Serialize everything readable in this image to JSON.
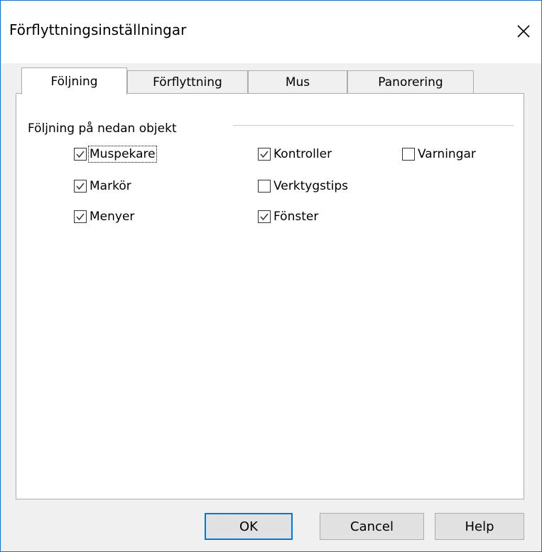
{
  "window": {
    "title": "Förflyttningsinställningar"
  },
  "tabs": [
    {
      "label": "Följning",
      "active": true
    },
    {
      "label": "Förflyttning",
      "active": false
    },
    {
      "label": "Mus",
      "active": false
    },
    {
      "label": "Panorering",
      "active": false
    }
  ],
  "group": {
    "label": "Följning på nedan objekt"
  },
  "checkboxes": [
    {
      "label": "Muspekare",
      "checked": true
    },
    {
      "label": "Markör",
      "checked": true
    },
    {
      "label": "Menyer",
      "checked": true
    },
    {
      "label": "Kontroller",
      "checked": true
    },
    {
      "label": "Verktygstips",
      "checked": false
    },
    {
      "label": "Fönster",
      "checked": true
    },
    {
      "label": "Varningar",
      "checked": false
    }
  ],
  "buttons": {
    "ok": "OK",
    "cancel": "Cancel",
    "help": "Help"
  }
}
